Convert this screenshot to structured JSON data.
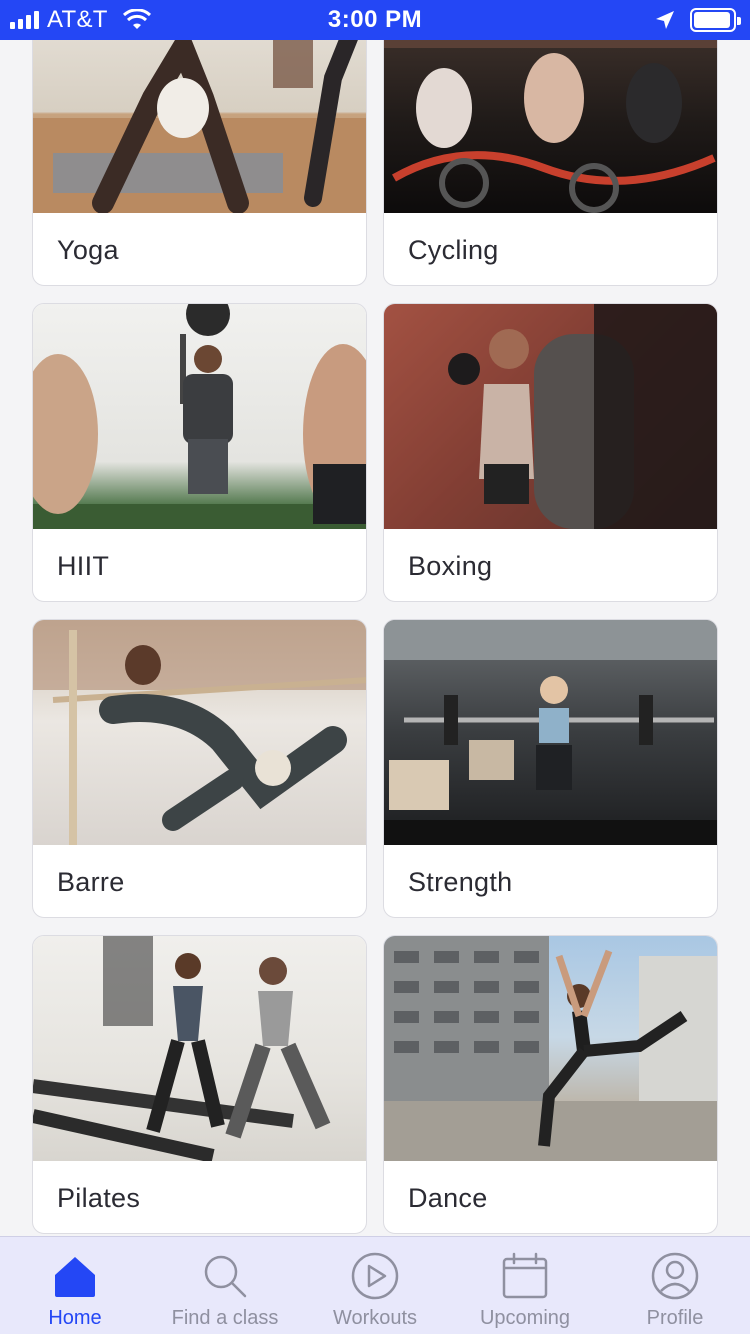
{
  "status_bar": {
    "carrier": "AT&T",
    "time": "3:00 PM"
  },
  "categories": [
    {
      "label": "Yoga"
    },
    {
      "label": "Cycling"
    },
    {
      "label": "HIIT"
    },
    {
      "label": "Boxing"
    },
    {
      "label": "Barre"
    },
    {
      "label": "Strength"
    },
    {
      "label": "Pilates"
    },
    {
      "label": "Dance"
    }
  ],
  "tab_bar": {
    "items": [
      {
        "label": "Home",
        "icon": "home-icon",
        "active": true
      },
      {
        "label": "Find a class",
        "icon": "search-icon",
        "active": false
      },
      {
        "label": "Workouts",
        "icon": "play-icon",
        "active": false
      },
      {
        "label": "Upcoming",
        "icon": "calendar-icon",
        "active": false
      },
      {
        "label": "Profile",
        "icon": "profile-icon",
        "active": false
      }
    ]
  },
  "colors": {
    "accent": "#2447f5",
    "tab_inactive": "#8f90a0",
    "tab_bar_bg": "#e8e8fb"
  }
}
